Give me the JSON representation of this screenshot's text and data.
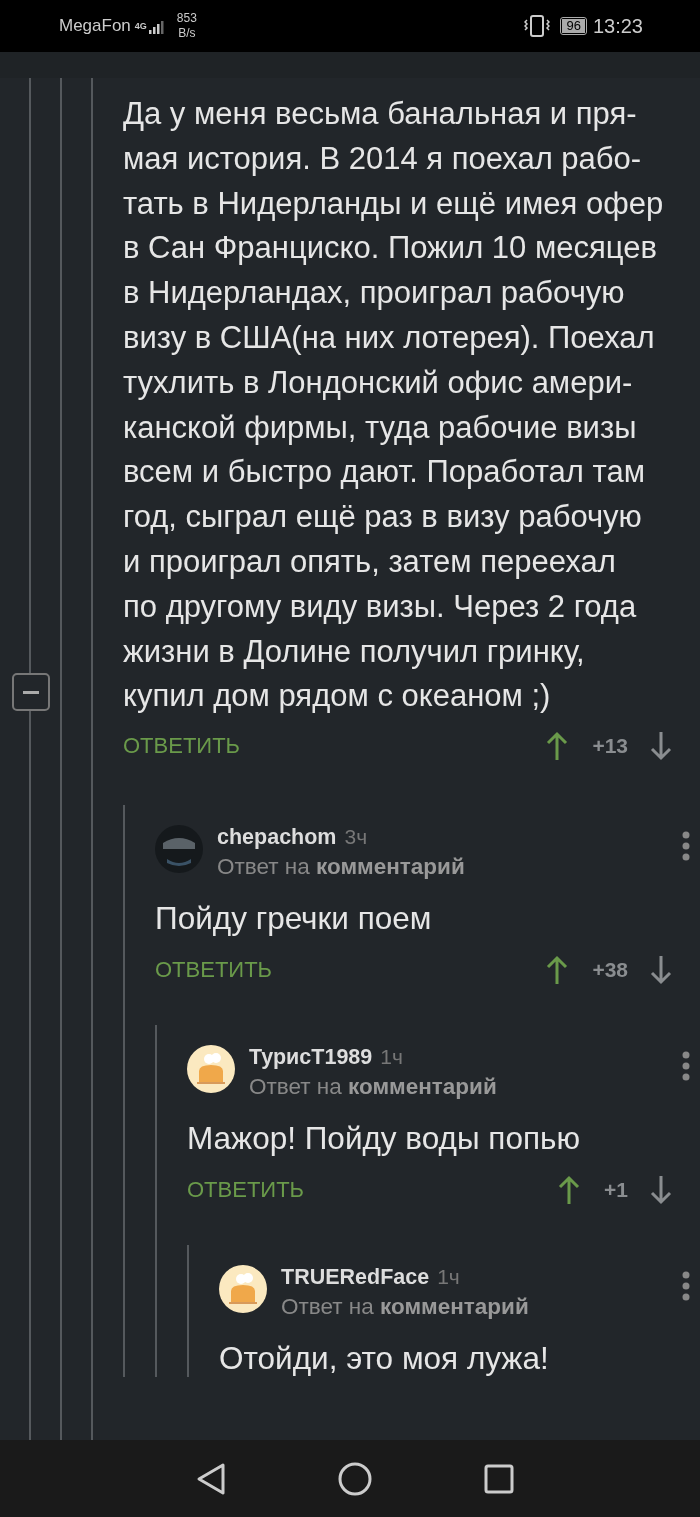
{
  "status_bar": {
    "carrier": "MegaFon",
    "network": "4G",
    "speed": "853",
    "speed_unit": "B/s",
    "battery": "96",
    "time": "13:23"
  },
  "thread": {
    "expanded": true,
    "lines": [
      "Да у меня весьма банальная и пря-",
      "мая история. В 2014 я поехал рабо-",
      "тать в Нидерланды и ещё имея офер",
      "в Сан Франциско. Пожил 10 месяцев",
      "в Нидерландах, проиграл рабочую",
      "визу в США(на них лотерея). Поехал",
      "тухлить в Лондонский офис амери-",
      "канской фирмы, туда рабочие визы",
      "всем и быстро дают. Поработал там",
      "год, сыграл ещё раз в визу рабочую",
      "и проиграл опять, затем переехал",
      "по другому виду визы. Через 2 года",
      "жизни в Долине получил гринку,",
      "купил дом рядом с океаном ;)"
    ],
    "reply_label": "ОТВЕТИТЬ",
    "rating": "+13",
    "replies": [
      {
        "author": "chepachom",
        "time": "3ч",
        "kind": "dark",
        "reply_to": "Ответ на **комментарий**",
        "text": "Пойду гречки поем",
        "reply_label": "ОТВЕТИТЬ",
        "rating": "+38",
        "replies": [
          {
            "author": "ТурисТ1989",
            "time": "1ч",
            "kind": "chef",
            "reply_to": "Ответ на **комментарий**",
            "text": "Мажор! Пойду воды попью",
            "reply_label": "ОТВЕТИТЬ",
            "rating": "+1",
            "replies": [
              {
                "author": "TRUERedFace",
                "time": "1ч",
                "kind": "chef",
                "reply_to": "Ответ на **комментарий**",
                "text": "Отойди, это моя лужа!"
              }
            ]
          }
        ]
      }
    ]
  }
}
